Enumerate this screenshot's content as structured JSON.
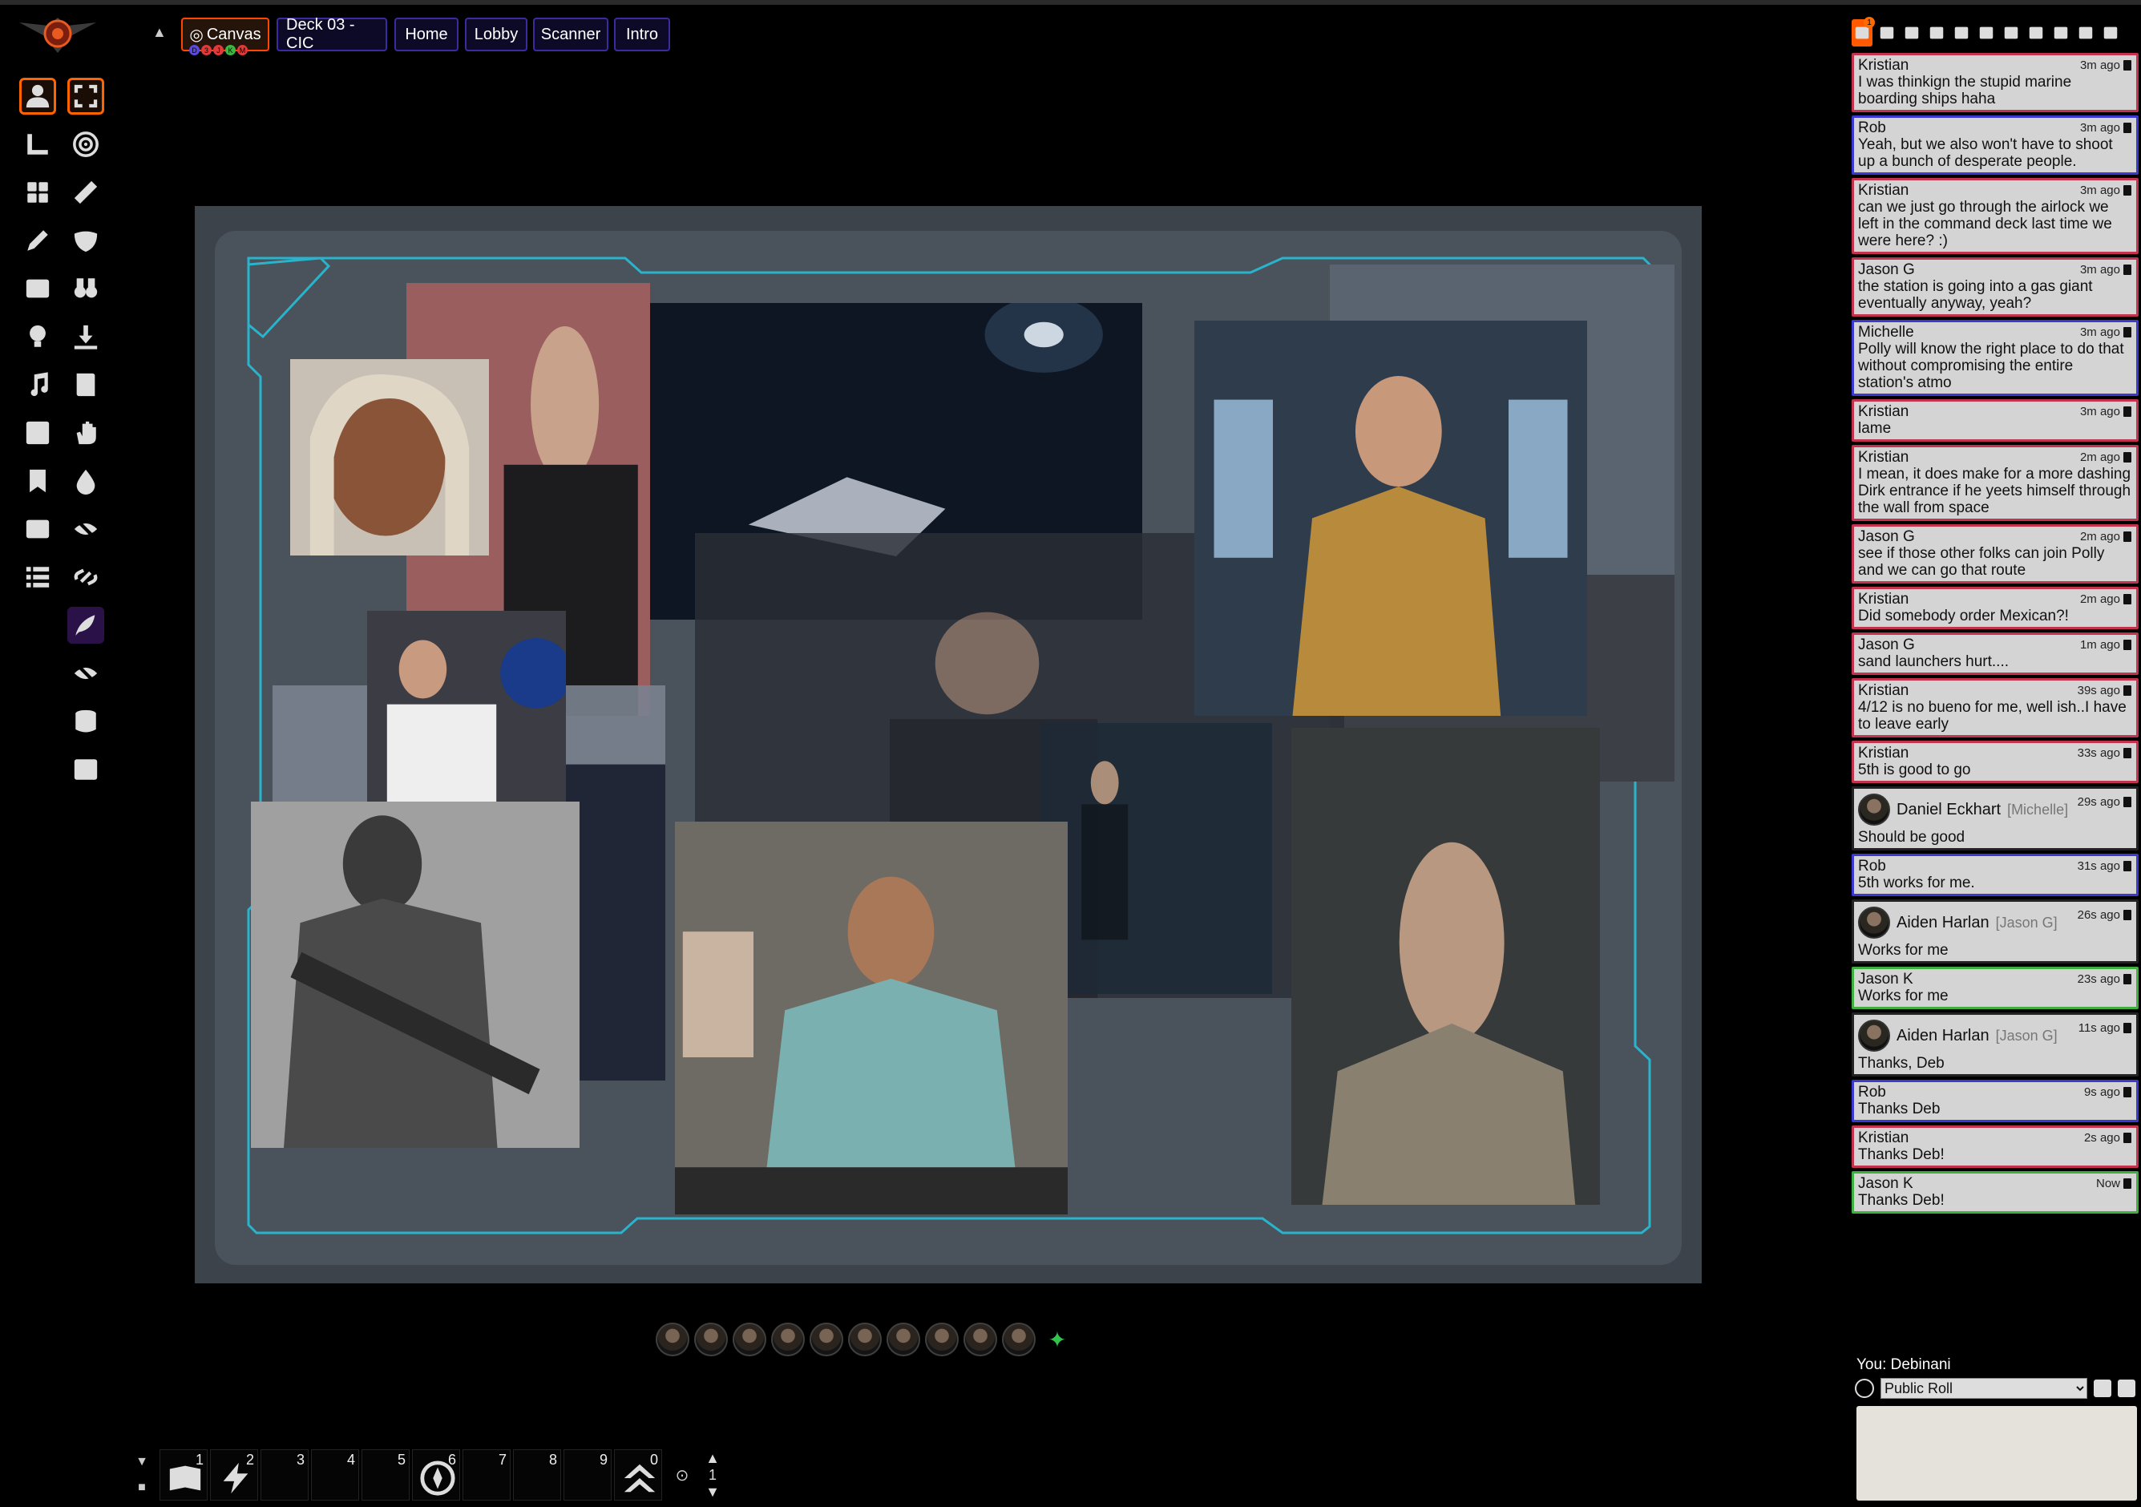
{
  "nav": {
    "tabs": [
      {
        "label": "Canvas",
        "icon": "target-icon"
      },
      {
        "label": "Deck 03 - CIC"
      },
      {
        "label": "Home"
      },
      {
        "label": "Lobby"
      },
      {
        "label": "Scanner"
      },
      {
        "label": "Intro"
      }
    ],
    "canvas_dots": [
      "D",
      "3",
      "J",
      "K",
      "M"
    ]
  },
  "toolbar": {
    "tools": [
      "user-icon",
      "fullscreen-icon",
      "ruler-icon",
      "target-icon",
      "dice-icon",
      "ruler-alt-icon",
      "pencil-icon",
      "mask-icon",
      "wall-icon",
      "binoculars-icon",
      "lightbulb-icon",
      "download-icon",
      "music-note-icon",
      "book-icon",
      "checker-icon",
      "hand-icon",
      "bookmark-icon",
      "drop-icon",
      "window-icon",
      "eye-slash-icon",
      "list-icon",
      "link-icon",
      "feather-icon",
      "eye-off-icon",
      "database-icon",
      "film-icon"
    ]
  },
  "hotbar": {
    "slots": [
      {
        "num": "1",
        "icon": "book-open-icon"
      },
      {
        "num": "2",
        "icon": "lightning-icon"
      },
      {
        "num": "3"
      },
      {
        "num": "4"
      },
      {
        "num": "5"
      },
      {
        "num": "6",
        "icon": "compass-icon"
      },
      {
        "num": "7"
      },
      {
        "num": "8"
      },
      {
        "num": "9"
      },
      {
        "num": "0",
        "icon": "chevrons-up-icon"
      }
    ],
    "page": "1"
  },
  "sidebar": {
    "chat_badge": "1",
    "messages": [
      {
        "speaker": "Kristian",
        "time": "3m ago",
        "text": "I was thinkign the stupid marine boarding ships haha",
        "color": "#c4334d"
      },
      {
        "speaker": "Rob",
        "time": "3m ago",
        "text": "Yeah, but we also won't have to shoot up a bunch of desperate people.",
        "color": "#3a3ad0"
      },
      {
        "speaker": "Kristian",
        "time": "3m ago",
        "text": "can we just go through the airlock we left in the command deck last time we were here? :)",
        "color": "#c4334d"
      },
      {
        "speaker": "Jason G",
        "time": "3m ago",
        "text": "the station is going into a gas giant eventually anyway, yeah?",
        "color": "#c4334d"
      },
      {
        "speaker": "Michelle",
        "time": "3m ago",
        "text": "Polly will know the right place to do that without compromising the entire station's atmo",
        "color": "#3a3ad0"
      },
      {
        "speaker": "Kristian",
        "time": "3m ago",
        "text": "lame",
        "color": "#c4334d"
      },
      {
        "speaker": "Kristian",
        "time": "2m ago",
        "text": "I mean, it does make for a more dashing Dirk entrance if he yeets himself through the wall from space",
        "color": "#c4334d"
      },
      {
        "speaker": "Jason G",
        "time": "2m ago",
        "text": "see if those other folks can join Polly and we can go that route",
        "color": "#c4334d"
      },
      {
        "speaker": "Kristian",
        "time": "2m ago",
        "text": "Did somebody order Mexican?!",
        "color": "#c4334d"
      },
      {
        "speaker": "Jason G",
        "time": "1m ago",
        "text": "sand launchers hurt....",
        "color": "#c4334d"
      },
      {
        "speaker": "Kristian",
        "time": "39s ago",
        "text": "4/12 is no bueno for me, well ish..I have to leave early",
        "color": "#c4334d"
      },
      {
        "speaker": "Kristian",
        "time": "33s ago",
        "text": "5th is good to go",
        "color": "#c4334d"
      },
      {
        "speaker": "Daniel Eckhart",
        "alias": "[Michelle]",
        "time": "29s ago",
        "text": "Should be good",
        "color": "#222222",
        "ic": true
      },
      {
        "speaker": "Rob",
        "time": "31s ago",
        "text": "5th works for me.",
        "color": "#3a3ad0"
      },
      {
        "speaker": "Aiden Harlan",
        "alias": "[Jason G]",
        "time": "26s ago",
        "text": "Works for me",
        "color": "#222222",
        "ic": true
      },
      {
        "speaker": "Jason K",
        "time": "23s ago",
        "text": "Works for me",
        "color": "#3fb03f"
      },
      {
        "speaker": "Aiden Harlan",
        "alias": "[Jason G]",
        "time": "11s ago",
        "text": "Thanks, Deb",
        "color": "#222222",
        "ic": true
      },
      {
        "speaker": "Rob",
        "time": "9s ago",
        "text": "Thanks Deb",
        "color": "#3a3ad0"
      },
      {
        "speaker": "Kristian",
        "time": "2s ago",
        "text": "Thanks Deb!",
        "color": "#c4334d"
      },
      {
        "speaker": "Jason K",
        "time": "Now",
        "text": "Thanks Deb!",
        "color": "#3fb03f"
      }
    ],
    "you_label": "You: Debinani",
    "roll_mode": "Public Roll"
  },
  "players": [
    "player",
    "player",
    "player",
    "player",
    "player",
    "player",
    "player",
    "player",
    "player",
    "player"
  ]
}
